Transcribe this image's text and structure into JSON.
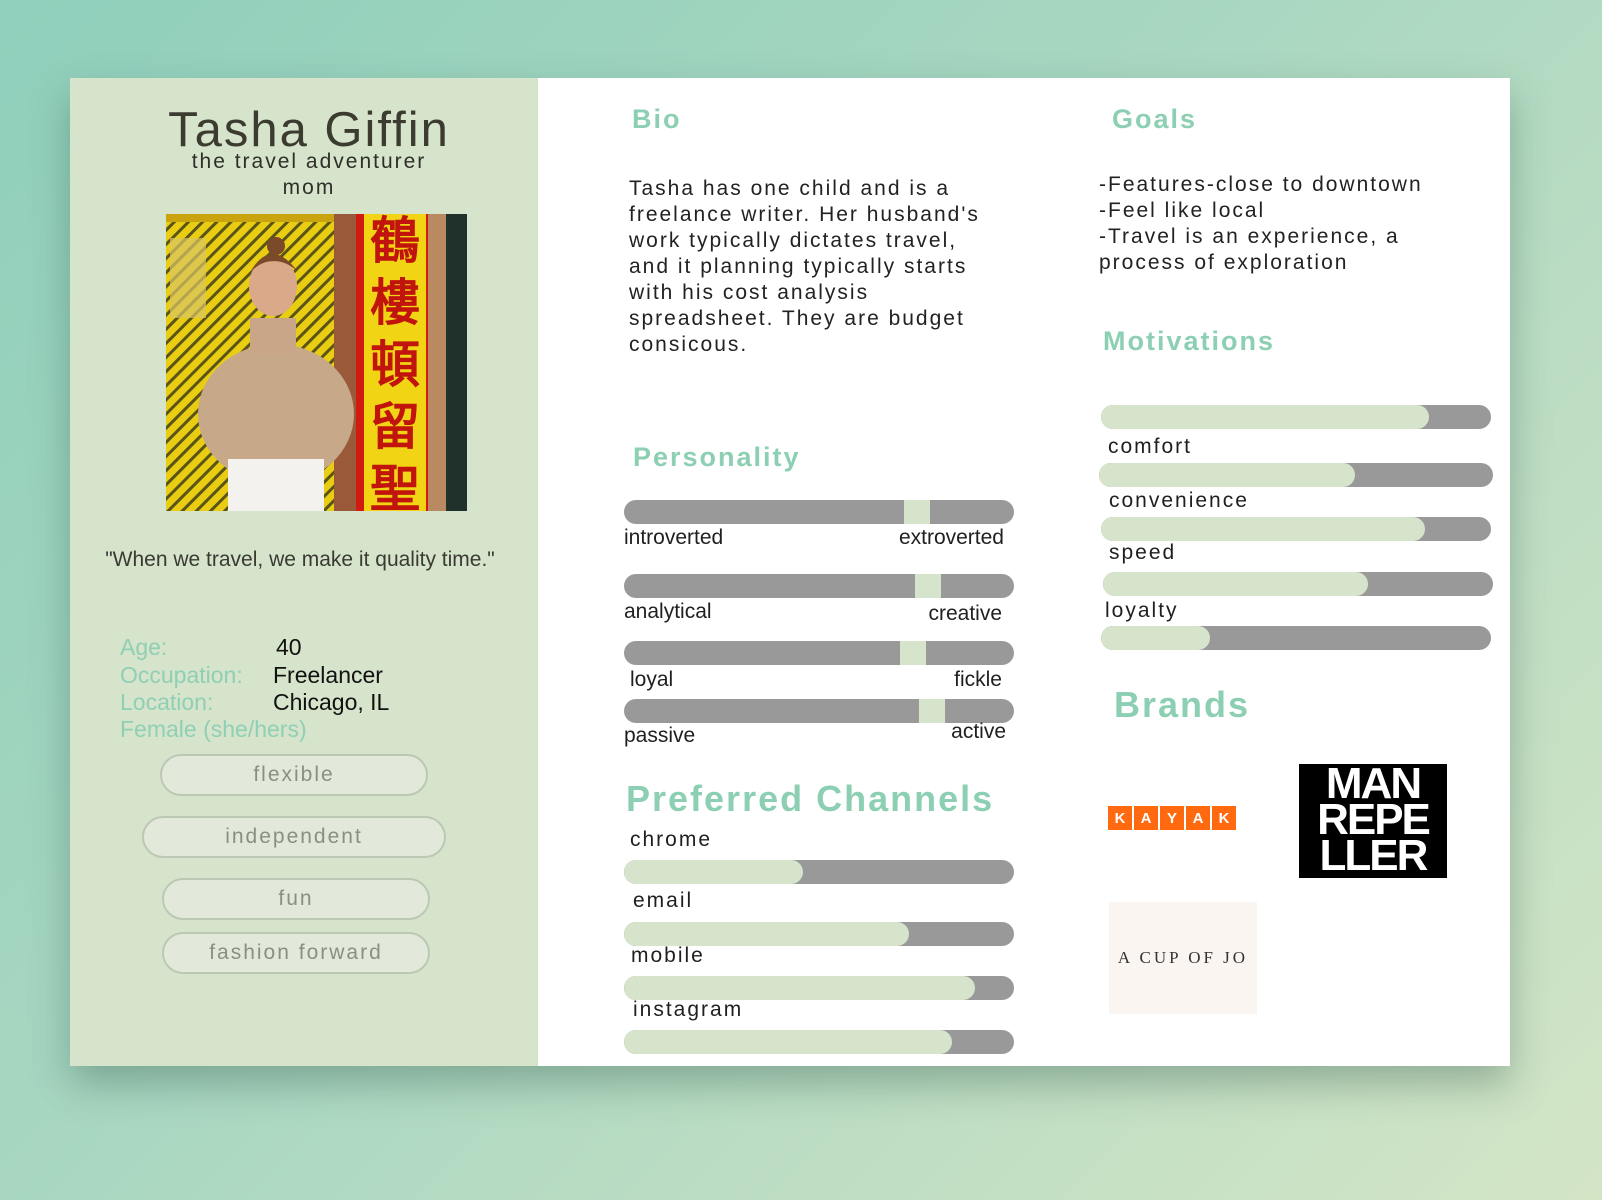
{
  "profile": {
    "name": "Tasha Giffin",
    "tagline_1": "the travel adventurer",
    "tagline_2": "mom",
    "quote": "\"When we travel, we make it quality time.\"",
    "age_label": "Age:",
    "age": "40",
    "occupation_label": "Occupation:",
    "occupation": "Freelancer",
    "location_label": "Location:",
    "location": "Chicago, IL",
    "gender": "Female (she/hers)",
    "traits": [
      "flexible",
      "independent",
      "fun",
      "fashion forward"
    ],
    "photo_chars": [
      "鶴",
      "樓",
      "頓",
      "留",
      "聖"
    ]
  },
  "bio": {
    "title": "Bio",
    "text": "Tasha has one child and is a freelance writer. Her husband's work typically dictates travel, and it planning typically starts with his cost analysis spreadsheet. They are budget consicous."
  },
  "goals": {
    "title": "Goals",
    "items": [
      "-Features-close to downtown",
      "-Feel like local",
      "-Travel is an experience, a process of exploration"
    ]
  },
  "personality": {
    "title": "Personality",
    "scales": [
      {
        "left": "introverted",
        "right": "extroverted",
        "value": 0.75
      },
      {
        "left": "analytical",
        "right": "creative",
        "value": 0.78
      },
      {
        "left": "loyal",
        "right": "fickle",
        "value": 0.74
      },
      {
        "left": "passive",
        "right": "active",
        "value": 0.79
      }
    ]
  },
  "motivations": {
    "title": "Motivations",
    "items": [
      {
        "label": "comfort",
        "value": 0.84
      },
      {
        "label": "convenience",
        "value": 0.65
      },
      {
        "label": "speed",
        "value": 0.83
      },
      {
        "label": "loyalty",
        "value": 0.68
      }
    ],
    "extra_bar_value": 0.28
  },
  "channels": {
    "title": "Preferred Channels",
    "items": [
      {
        "label": "chrome",
        "value": 0.46
      },
      {
        "label": "email",
        "value": 0.73
      },
      {
        "label": "mobile",
        "value": 0.9
      },
      {
        "label": "instagram",
        "value": 0.84
      }
    ]
  },
  "brands": {
    "title": "Brands",
    "kayak_letters": [
      "K",
      "A",
      "Y",
      "A",
      "K"
    ],
    "man_repeller": [
      "MAN",
      "REPE",
      "LLER"
    ],
    "cup_of_jo": "A CUP OF JO"
  },
  "colors": {
    "accent": "#8ccfb2",
    "panel": "#d6e4cb",
    "track": "#999999",
    "kayak": "#ff690f"
  }
}
